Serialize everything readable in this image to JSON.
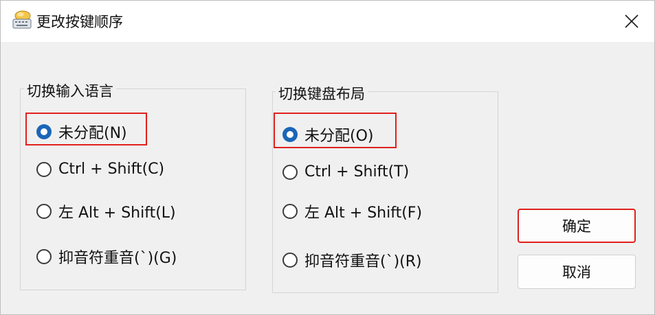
{
  "window": {
    "title": "更改按键顺序",
    "icon": "keyboard-icon",
    "close_icon": "close-icon"
  },
  "input_language": {
    "title": "切换输入语言",
    "options": [
      {
        "label": "未分配(N)",
        "checked": true
      },
      {
        "label": "Ctrl + Shift(C)",
        "checked": false
      },
      {
        "label": "左 Alt + Shift(L)",
        "checked": false
      },
      {
        "label": "抑音符重音(`)(G)",
        "checked": false
      }
    ]
  },
  "keyboard_layout": {
    "title": "切换键盘布局",
    "options": [
      {
        "label": "未分配(O)",
        "checked": true
      },
      {
        "label": "Ctrl + Shift(T)",
        "checked": false
      },
      {
        "label": "左 Alt + Shift(F)",
        "checked": false
      },
      {
        "label": "抑音符重音(`)(R)",
        "checked": false
      }
    ]
  },
  "buttons": {
    "ok": "确定",
    "cancel": "取消"
  },
  "colors": {
    "highlight": "#e0201c",
    "radio_selected": "#1a66b8",
    "background": "#f0f0f0"
  }
}
